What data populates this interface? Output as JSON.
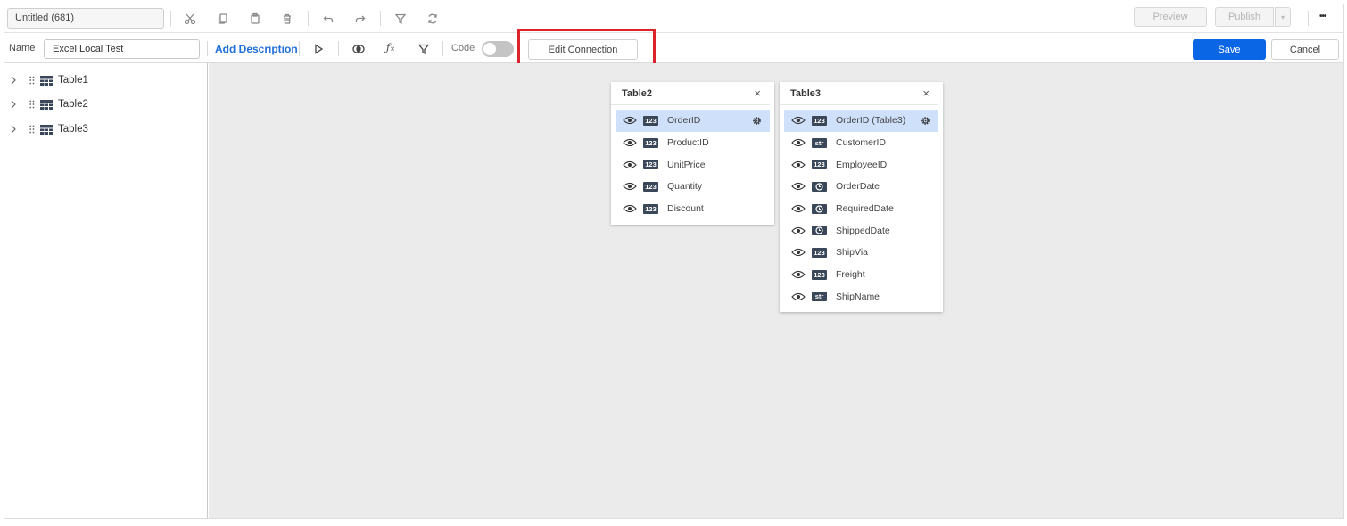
{
  "window": {
    "title": "Untitled (681)"
  },
  "toolbar": {
    "preview_label": "Preview",
    "publish_label": "Publish",
    "more_label": "•••"
  },
  "query": {
    "name_label": "Name",
    "name_value": "Excel Local Test",
    "add_description": "Add Description",
    "code_label": "Code",
    "edit_connection": "Edit Connection",
    "save_label": "Save",
    "cancel_label": "Cancel",
    "accent_color": "#0a66e4",
    "highlight_color": "#d9232d"
  },
  "tree": {
    "items": [
      {
        "label": "Table1"
      },
      {
        "label": "Table2"
      },
      {
        "label": "Table3"
      }
    ]
  },
  "tables": [
    {
      "title": "Table2",
      "close": "×",
      "fields": [
        {
          "type": "123",
          "name": "OrderID",
          "selected": true
        },
        {
          "type": "123",
          "name": "ProductID"
        },
        {
          "type": "123",
          "name": "UnitPrice"
        },
        {
          "type": "123",
          "name": "Quantity"
        },
        {
          "type": "123",
          "name": "Discount"
        }
      ]
    },
    {
      "title": "Table3",
      "close": "×",
      "fields": [
        {
          "type": "123",
          "name": "OrderID (Table3)",
          "selected": true
        },
        {
          "type": "str",
          "name": "CustomerID"
        },
        {
          "type": "123",
          "name": "EmployeeID"
        },
        {
          "type": "date",
          "name": "OrderDate"
        },
        {
          "type": "date",
          "name": "RequiredDate"
        },
        {
          "type": "date",
          "name": "ShippedDate"
        },
        {
          "type": "123",
          "name": "ShipVia"
        },
        {
          "type": "123",
          "name": "Freight"
        },
        {
          "type": "str",
          "name": "ShipName"
        }
      ]
    }
  ]
}
